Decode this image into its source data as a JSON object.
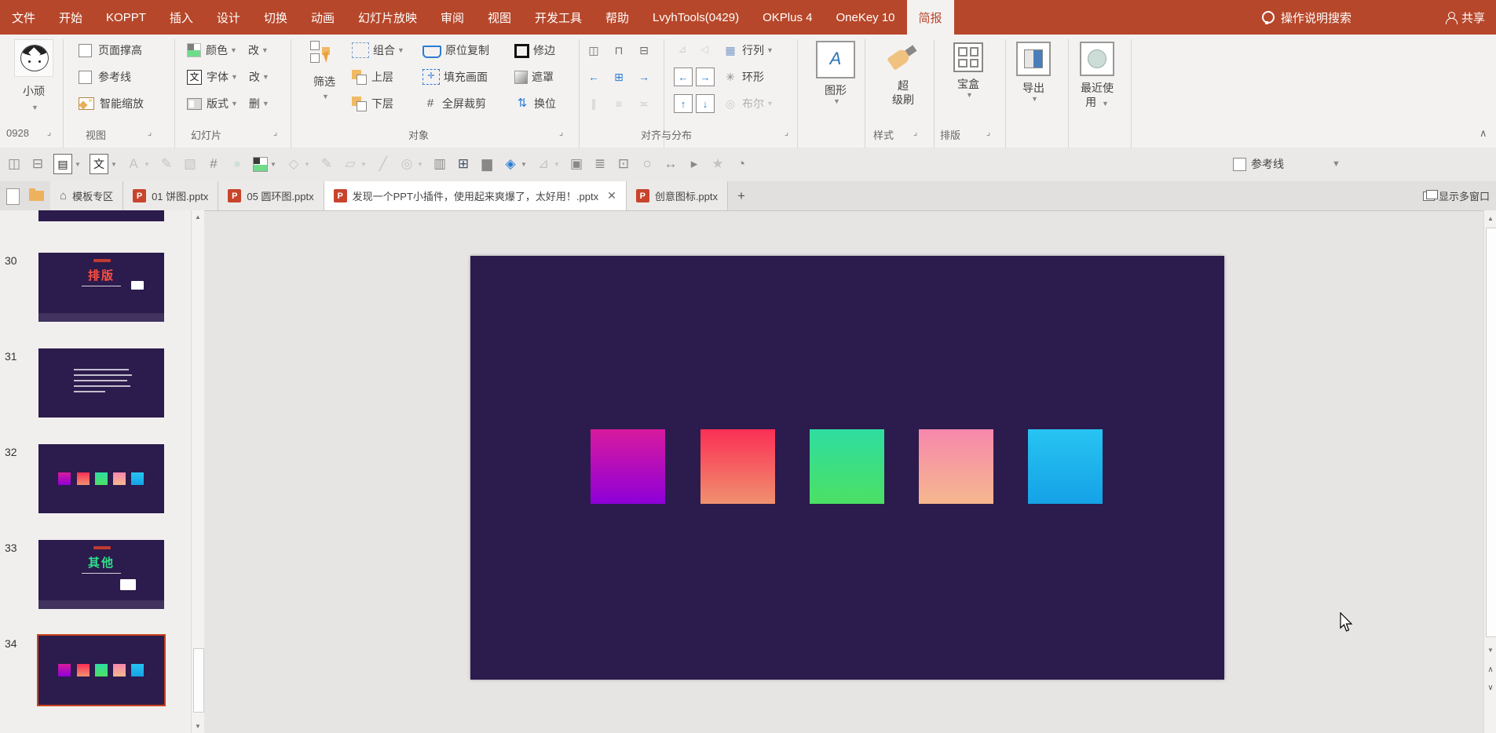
{
  "titlebar": {
    "tabs": [
      "文件",
      "开始",
      "KOPPT",
      "插入",
      "设计",
      "切换",
      "动画",
      "幻灯片放映",
      "审阅",
      "视图",
      "开发工具",
      "帮助",
      "LvyhTools(0429)",
      "OKPlus 4",
      "OneKey 10",
      "简报"
    ],
    "active_tab": "简报",
    "search_label": "操作说明搜索",
    "share_label": "共享"
  },
  "ribbon": {
    "avatar_label": "小顽",
    "view_items": [
      {
        "name": "page-height",
        "label": "页面撑高",
        "type": "checkbox"
      },
      {
        "name": "guides",
        "label": "参考线",
        "type": "checkbox"
      },
      {
        "name": "smart-zoom",
        "label": "智能缩放",
        "type": "pic"
      }
    ],
    "slide_rows": [
      {
        "icon": "color",
        "label": "颜色",
        "extra": "改"
      },
      {
        "icon": "font",
        "label": "字体",
        "extra": "改"
      },
      {
        "icon": "layout",
        "label": "版式",
        "extra": "删"
      }
    ],
    "filter_label": "筛选",
    "object_cols": [
      [
        {
          "label": "组合",
          "dd": true,
          "icon": "group"
        },
        {
          "label": "上层",
          "icon": "front"
        },
        {
          "label": "下层",
          "icon": "back"
        }
      ],
      [
        {
          "label": "原位复制",
          "icon": "copy"
        },
        {
          "label": "填充画面",
          "icon": "fill"
        },
        {
          "label": "全屏裁剪",
          "icon": "crop"
        }
      ],
      [
        {
          "label": "修边",
          "icon": "trim"
        },
        {
          "label": "遮罩",
          "icon": "mask"
        },
        {
          "label": "换位",
          "icon": "swap"
        }
      ]
    ],
    "align_grid": [
      [
        {
          "name": "horizontal-center-align-icon",
          "glyph": "◫",
          "c": "#6b6966"
        },
        {
          "name": "top-align-icon",
          "glyph": "⊓",
          "c": "#6b6966"
        },
        {
          "name": "vertical-center-align-icon",
          "glyph": "⊟",
          "c": "#6b6966"
        }
      ],
      [
        {
          "name": "left-align-icon",
          "glyph": "←",
          "c": "#2b7cd3"
        },
        {
          "name": "center-align-icon",
          "glyph": "⊞",
          "c": "#2b7cd3"
        },
        {
          "name": "right-align-icon",
          "glyph": "→",
          "c": "#2b7cd3"
        }
      ],
      [
        {
          "name": "distribute-horizontal-icon",
          "glyph": "∥",
          "dis": true
        },
        {
          "name": "distribute-vertical-icon",
          "glyph": "≡",
          "dis": true
        },
        {
          "name": "equalize-icon",
          "glyph": "≍",
          "dis": true
        }
      ]
    ],
    "flip_grid": [
      [
        {
          "name": "flip-horizontal-icon",
          "glyph": "⊿",
          "dis": true
        },
        {
          "name": "flip-vertical-icon",
          "glyph": "◁",
          "dis": true
        }
      ],
      [
        {
          "name": "move-left-icon",
          "glyph": "←",
          "box": true,
          "c": "#2b7cd3"
        },
        {
          "name": "move-right-icon",
          "glyph": "→",
          "box": true,
          "c": "#2b7cd3"
        }
      ],
      [
        {
          "name": "move-up-icon",
          "glyph": "↑",
          "box": true,
          "c": "#2b7cd3"
        },
        {
          "name": "move-down-icon",
          "glyph": "↓",
          "box": true,
          "c": "#2b7cd3"
        }
      ]
    ],
    "arrange_items": [
      {
        "label": "行列",
        "dd": true,
        "glyph": "▦",
        "name": "rows-columns"
      },
      {
        "label": "环形",
        "glyph": "✳",
        "name": "ring-layout"
      },
      {
        "label": "布尔",
        "dd": true,
        "glyph": "◎",
        "name": "boolean",
        "dis": true
      }
    ],
    "big_buttons": [
      {
        "name": "shapes",
        "label": "图形",
        "dd": true,
        "icon": "shape-a"
      },
      {
        "name": "super-brush",
        "label": "超级刷",
        "icon": "brush"
      },
      {
        "name": "treasure-box",
        "label": "宝盒",
        "dd": true,
        "icon": "grid4"
      },
      {
        "name": "export",
        "label": "导出",
        "dd": true,
        "icon": "export"
      },
      {
        "name": "recent",
        "label": "最近使用",
        "dd": true,
        "icon": "recent"
      }
    ],
    "group_labels": [
      "0928",
      "视图",
      "幻灯片",
      "对象",
      "对齐与分布",
      "样式",
      "排版"
    ]
  },
  "qat": {
    "icons": [
      {
        "name": "align-objects-center-icon",
        "glyph": "◫"
      },
      {
        "name": "align-objects-middle-icon",
        "glyph": "⊟"
      },
      {
        "name": "text-style-icon",
        "glyph": "▤",
        "box": true,
        "dd": true
      },
      {
        "name": "font-format-icon",
        "glyph": "文",
        "box": true,
        "dd": true
      },
      {
        "name": "font-size-icon",
        "glyph": "A",
        "dd": true,
        "dis": true
      },
      {
        "name": "format-painter-pen-icon",
        "glyph": "✎",
        "dis": true
      },
      {
        "name": "picture-restore-icon",
        "glyph": "▧",
        "dis": true
      },
      {
        "name": "crop-icon",
        "glyph": "#"
      },
      {
        "name": "shape-ellipse-icon",
        "glyph": "●",
        "c": "#cfe0da"
      },
      {
        "name": "theme-color-swatch-icon",
        "glyph": "SWATCH",
        "dd": true
      },
      {
        "name": "ink-shape-icon",
        "glyph": "◇",
        "dd": true,
        "dis": true
      },
      {
        "name": "pen-tool-icon",
        "glyph": "✎",
        "dis": true
      },
      {
        "name": "text-box-edit-icon",
        "glyph": "▱",
        "dd": true,
        "dis": true
      },
      {
        "name": "eyedropper-icon",
        "glyph": "╱",
        "dis": true
      },
      {
        "name": "boolean-ops-icon",
        "glyph": "◎",
        "dd": true,
        "dis": true
      },
      {
        "name": "distribute-columns-icon",
        "glyph": "▥"
      },
      {
        "name": "table-style-icon",
        "glyph": "⊞",
        "c": "#44546a"
      },
      {
        "name": "chart-icon",
        "glyph": "▆"
      },
      {
        "name": "merge-shapes-icon",
        "glyph": "◈",
        "dd": true,
        "c": "#2b7cd3"
      },
      {
        "name": "flip-shape-icon",
        "glyph": "⊿",
        "dd": true,
        "dis": true
      },
      {
        "name": "copy-format-icon",
        "glyph": "▣"
      },
      {
        "name": "align-text-icon",
        "glyph": "≣"
      },
      {
        "name": "position-icon",
        "glyph": "⊡"
      },
      {
        "name": "rotate-icon",
        "glyph": "◌"
      },
      {
        "name": "resize-icon",
        "glyph": "↔"
      },
      {
        "name": "selection-pane-icon",
        "glyph": "▸"
      },
      {
        "name": "animation-icon",
        "glyph": "★",
        "dis": true
      },
      {
        "name": "zoom-level-icon",
        "glyph": "◔"
      }
    ],
    "guides_label": "参考线"
  },
  "tabbar": {
    "docs": [
      {
        "label": "模板专区",
        "icon": "home"
      },
      {
        "label": "01 饼图.pptx",
        "icon": "ppt"
      },
      {
        "label": "05 圆环图.pptx",
        "icon": "ppt"
      },
      {
        "label": "发现一个PPT小插件，使用起来爽爆了，太好用！.pptx",
        "icon": "ppt",
        "active": true,
        "closable": true
      },
      {
        "label": "创意图标.pptx",
        "icon": "ppt"
      }
    ],
    "new_tab_label": "+",
    "multi_window_label": "显示多窗口"
  },
  "slide_panel": {
    "slides": [
      {
        "num": "30",
        "kind": "title",
        "title": "排版",
        "title_color": "#ff5040"
      },
      {
        "num": "31",
        "kind": "text"
      },
      {
        "num": "32",
        "kind": "squares"
      },
      {
        "num": "33",
        "kind": "title",
        "title": "其他",
        "title_color": "#2fe08a"
      },
      {
        "num": "34",
        "kind": "squares",
        "selected": true
      }
    ],
    "selected_border": "#c8451f"
  },
  "canvas": {
    "bg": "#2c1b4d",
    "squares": [
      {
        "name": "gradient-square-magenta",
        "from": "#d81a9e",
        "to": "#8e00d8"
      },
      {
        "name": "gradient-square-red",
        "from": "#fb2f55",
        "to": "#f0916f"
      },
      {
        "name": "gradient-square-green",
        "from": "#2fdda1",
        "to": "#4ce064"
      },
      {
        "name": "gradient-square-pink",
        "from": "#f787ac",
        "to": "#f6b88e"
      },
      {
        "name": "gradient-square-cyan",
        "from": "#27c4f2",
        "to": "#15a2e6"
      }
    ]
  }
}
